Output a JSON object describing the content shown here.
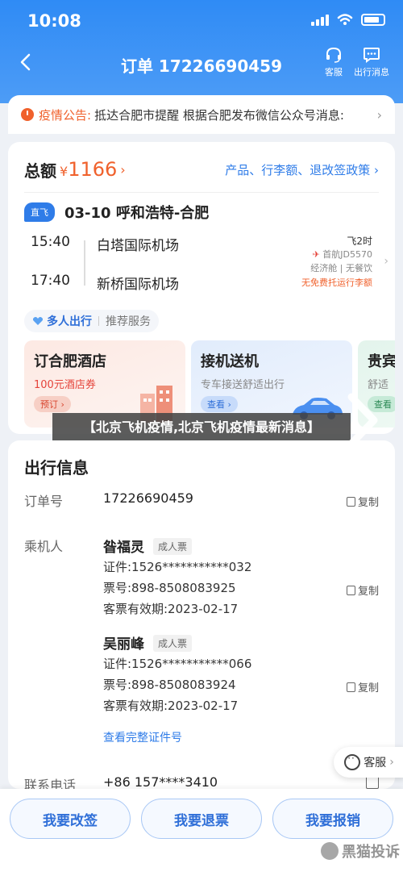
{
  "status": {
    "time": "10:08"
  },
  "nav": {
    "title": "订单 17226690459",
    "service_label": "客服",
    "messages_label": "出行消息"
  },
  "notice": {
    "label": "疫情公告:",
    "text": "抵达合肥市提醒 根据合肥发布微信公众号消息:"
  },
  "order": {
    "total_label": "总额",
    "currency": "¥",
    "total": "1166",
    "links": "产品、行李额、退改签政策"
  },
  "flight": {
    "badge": "直飞",
    "route": "03-10 呼和浩特-合肥",
    "depart_time": "15:40",
    "depart_airport": "白塔国际机场",
    "arrive_time": "17:40",
    "arrive_airport": "新桥国际机场",
    "duration": "飞2时",
    "flight_no": "首航JD5570",
    "cabin": "经济舱 | 无餐饮",
    "baggage": "无免费托运行李额"
  },
  "services": {
    "multi_label": "多人出行",
    "recommend": "推荐服务",
    "hotel": {
      "title": "订合肥酒店",
      "sub": "100元酒店券",
      "btn": "预订"
    },
    "car": {
      "title": "接机送机",
      "sub": "专车接送舒适出行",
      "btn": "查看"
    },
    "vip": {
      "title": "贵宾",
      "sub": "舒适",
      "btn": "查看"
    }
  },
  "overlay_text": "【北京飞机疫情,北京飞机疫情最新消息】",
  "travel": {
    "title": "出行信息",
    "order_no_label": "订单号",
    "order_no": "17226690459",
    "copy": "复制",
    "passenger_label": "乘机人",
    "adult": "成人票",
    "passengers": [
      {
        "name": "昝福灵",
        "id": "证件:1526***********032",
        "ticket": "票号:898-8508083925",
        "valid": "客票有效期:2023-02-17"
      },
      {
        "name": "吴丽峰",
        "id": "证件:1526***********066",
        "ticket": "票号:898-8508083924",
        "valid": "客票有效期:2023-02-17"
      }
    ],
    "view_id": "查看完整证件号",
    "phone_label": "联系电话",
    "phone": "+86 157****3410"
  },
  "cs_float": "客服",
  "buttons": {
    "change": "我要改签",
    "refund": "我要退票",
    "reimburse": "我要报销"
  },
  "watermark": "黑猫投诉",
  "colors": {
    "primary": "#2f8bf5",
    "accent": "#f0612c",
    "link": "#2f7ce8"
  }
}
